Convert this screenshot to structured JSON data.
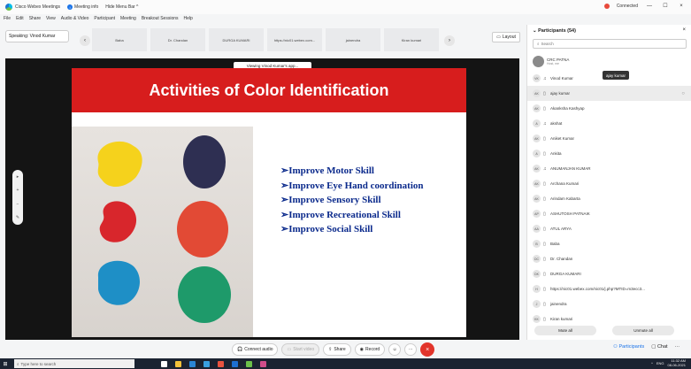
{
  "titlebar": {
    "app_name": "Cisco Webex Meetings",
    "meeting_info": "Meeting info",
    "hide_menu_bar": "Hide Menu Bar ^",
    "connected": "Connected",
    "minimize": "—",
    "maximize": "☐",
    "close": "×"
  },
  "menubar": [
    "File",
    "Edit",
    "Share",
    "View",
    "Audio & Video",
    "Participant",
    "Meeting",
    "Breakout Sessions",
    "Help"
  ],
  "speaking": "Speaking: Vinod Kumar",
  "thumbnails": [
    "Baba",
    "Dr. Chandan",
    "DURGA KUMARI",
    "https://nic01.webex.com...",
    "jainendra",
    "Kiran kumari"
  ],
  "layout_label": "Layout",
  "viewing_label": "Viewing Vinod Kumar's app...",
  "slide": {
    "title": "Activities of Color Identification",
    "bullets": [
      "➢Improve Motor Skill",
      "➢Improve Eye Hand coordination",
      "➢Improve Sensory Skill",
      "➢Improve Recreational Skill",
      "➢Improve Social Skill"
    ]
  },
  "toolbar": {
    "connect_audio": "Connect audio",
    "start_video": "Start video",
    "share": "Share",
    "record": "Record",
    "more": "···",
    "end": "×"
  },
  "participants": {
    "header": "Participants (54)",
    "search_placeholder": "Search",
    "host_name": "CRC PATNA",
    "host_role": "Host, me",
    "tooltip": "ajay kumar",
    "list": [
      {
        "initials": "VK",
        "name": "Vinod Kumar"
      },
      {
        "initials": "AK",
        "name": "ajay kumar"
      },
      {
        "initials": "AK",
        "name": "Akanksha Kashyap"
      },
      {
        "initials": "A",
        "name": "akshat"
      },
      {
        "initials": "AK",
        "name": "Aniket Kumar"
      },
      {
        "initials": "A",
        "name": "Ankita"
      },
      {
        "initials": "AK",
        "name": "ANUMANJAN KUMAR"
      },
      {
        "initials": "AK",
        "name": "Archana Kumari"
      },
      {
        "initials": "AK",
        "name": "Arindam Kabarta"
      },
      {
        "initials": "AP",
        "name": "ASHUTOSH PATNAIK"
      },
      {
        "initials": "AA",
        "name": "ATUL ARYA"
      },
      {
        "initials": "B",
        "name": "Baba"
      },
      {
        "initials": "DC",
        "name": "Dr. Chandan"
      },
      {
        "initials": "DK",
        "name": "DURGA KUMARI"
      },
      {
        "initials": "H",
        "name": "https://nic01.webex.com/nic01/j.php?MTID=m3ecc3..."
      },
      {
        "initials": "J",
        "name": "jainendra"
      },
      {
        "initials": "KK",
        "name": "Kiran kumari"
      }
    ],
    "mute_all": "Mute all",
    "unmute_all": "Unmute all"
  },
  "bottom_tabs": {
    "participants": "Participants",
    "chat": "Chat",
    "more": "···"
  },
  "taskbar": {
    "search_placeholder": "Type here to search",
    "tray_lang": "ENG",
    "time": "11:32 AM",
    "date": "08-06-2021"
  }
}
